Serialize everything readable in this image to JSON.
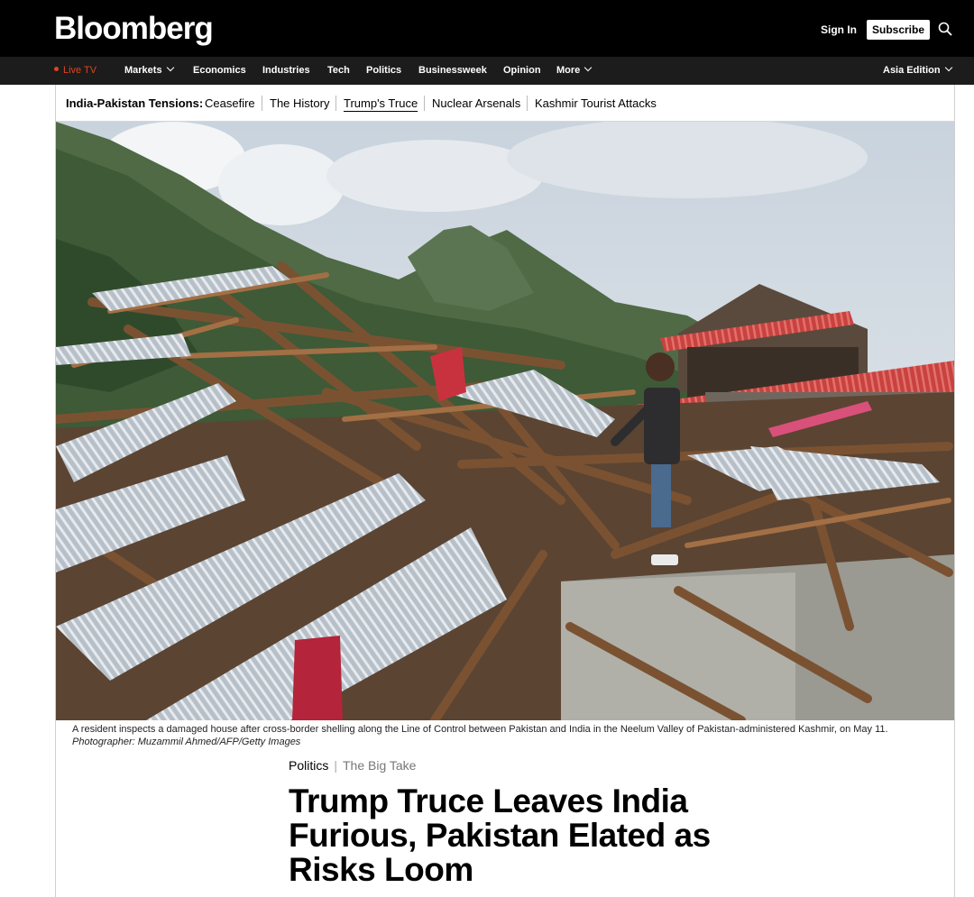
{
  "header": {
    "logo": "Bloomberg",
    "sign_in": "Sign In",
    "subscribe": "Subscribe",
    "search_icon": "search-icon"
  },
  "nav": {
    "live_tv": "Live TV",
    "items": [
      "Markets",
      "Economics",
      "Industries",
      "Tech",
      "Politics",
      "Businessweek",
      "Opinion",
      "More"
    ],
    "edition": "Asia Edition",
    "accent_color": "#e0441f"
  },
  "topics": {
    "label": "India-Pakistan Tensions:",
    "links": [
      "Ceasefire",
      "The History",
      "Trump's Truce",
      "Nuclear Arsenals",
      "Kashmir Tourist Attacks"
    ],
    "active": "Trump's Truce"
  },
  "caption": {
    "text": "A resident inspects a damaged house after cross-border shelling along the Line of Control between Pakistan and India in the Neelum Valley of Pakistan-administered Kashmir, on May 11.",
    "credit": "Photographer: Muzammil Ahmed/AFP/Getty Images"
  },
  "article": {
    "section": "Politics",
    "series": "The Big Take",
    "headline": "Trump Truce Leaves India Furious, Pakistan Elated as Risks Loom"
  }
}
